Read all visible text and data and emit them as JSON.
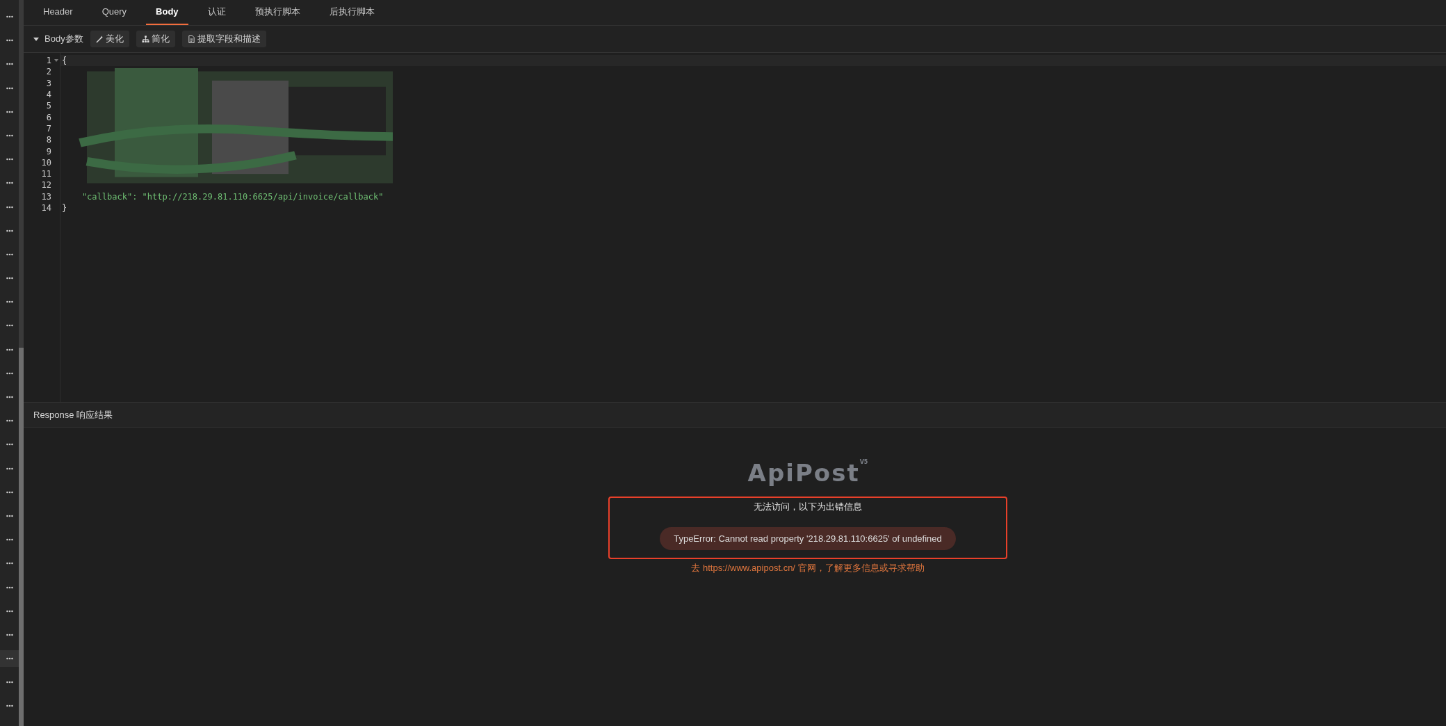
{
  "tabs": [
    {
      "label": "Header",
      "selected": false
    },
    {
      "label": "Query",
      "selected": false
    },
    {
      "label": "Body",
      "selected": true
    },
    {
      "label": "认证",
      "selected": false
    },
    {
      "label": "预执行脚本",
      "selected": false
    },
    {
      "label": "后执行脚本",
      "selected": false
    }
  ],
  "body_toolbar": {
    "title": "Body参数",
    "expanded": true,
    "buttons": [
      {
        "kind": "beautify",
        "label": "美化"
      },
      {
        "kind": "simplify",
        "label": "简化"
      },
      {
        "kind": "extract",
        "label": "提取字段和描述"
      }
    ]
  },
  "editor": {
    "lines": [
      {
        "number": "1",
        "code": "{",
        "foldable": true
      },
      {
        "number": "2"
      },
      {
        "number": "3"
      },
      {
        "number": "4"
      },
      {
        "number": "5"
      },
      {
        "number": "6"
      },
      {
        "number": "7"
      },
      {
        "number": "8"
      },
      {
        "number": "9"
      },
      {
        "number": "10"
      },
      {
        "number": "11"
      },
      {
        "number": "12"
      },
      {
        "number": "13",
        "code": "    \"callback\": \"http://218.29.81.110:6625/api/invoice/callback\"",
        "kind": "string"
      },
      {
        "number": "14",
        "code": "}"
      }
    ]
  },
  "response": {
    "title": "Response 响应结果",
    "logo": "ApiPost",
    "logo_version": "V5",
    "error_title": "无法访问，以下为出错信息",
    "error_message": "TypeError: Cannot read property '218.29.81.110:6625' of undefined",
    "help_prefix": "去 ",
    "help_link": "https://www.apipost.cn/",
    "help_suffix": " 官网，了解更多信息或寻求帮助"
  }
}
